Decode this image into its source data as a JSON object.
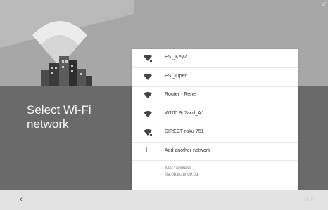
{
  "page": {
    "title": "Select Wi-Fi network"
  },
  "networks": [
    {
      "ssid": "ESI_Key2",
      "icon": "wifi-lock-icon"
    },
    {
      "ssid": "ESI_Open",
      "icon": "wifi-icon"
    },
    {
      "ssid": "Router - Rene",
      "icon": "wifi-icon"
    },
    {
      "ssid": "W100 9b7acd_AJ",
      "icon": "wifi-icon"
    },
    {
      "ssid": "DIRECT-roku-751",
      "icon": "wifi-lock-icon"
    }
  ],
  "add_network": {
    "label": "Add another network",
    "icon": "plus-icon"
  },
  "mac": {
    "label": "MAC address",
    "value": "0a:0b:ec:8f:d9:0d"
  },
  "nav": {
    "back_icon": "chevron-left-icon",
    "back_glyph": "‹",
    "skip_label": "SKIP",
    "skip_chevron": "›"
  },
  "colors": {
    "background_top": "#a7a7a7",
    "background_bottom": "#6a6a6a",
    "panel": "#ffffff",
    "bottom_bar": "#e3e3e3"
  }
}
